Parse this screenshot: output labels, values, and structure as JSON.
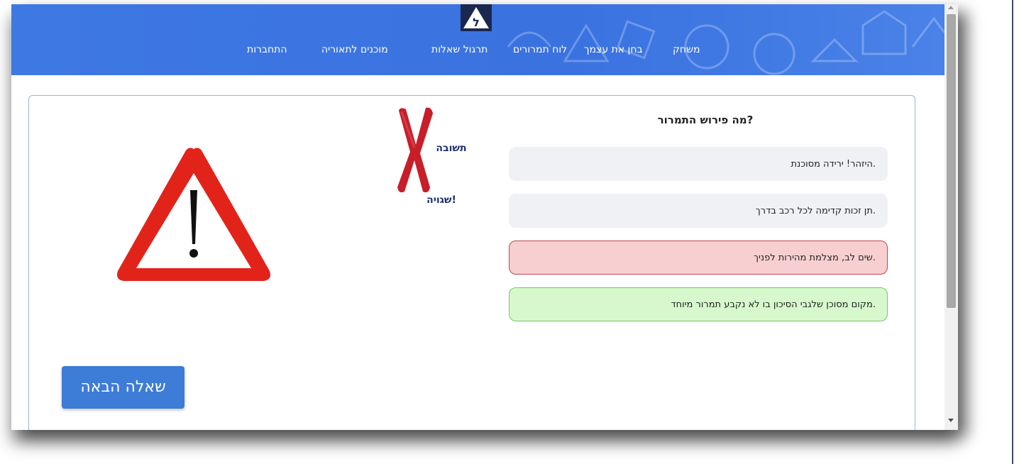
{
  "nav": {
    "items": [
      "משחק",
      "בחן את עצמך",
      "לוח תמרורים",
      "תרגול שאלות",
      "מוכנים לתאוריה",
      "התחברות"
    ]
  },
  "logo": {
    "glyph": "ל"
  },
  "quiz": {
    "question": "?מה פירוש התמרור",
    "options": [
      {
        "text": ".היזהר! ירידה מסוכנת",
        "state": "neutral"
      },
      {
        "text": ".תן זכות קדימה לכל רכב בדרך",
        "state": "neutral"
      },
      {
        "text": ".שים לב, מצלמת מהירות לפניך",
        "state": "wrong"
      },
      {
        "text": ".מקום מסוכן שלגבי הסיכון בו לא נקבע תמרור מיוחד",
        "state": "correct"
      }
    ],
    "answer_label": "תשובה",
    "answer_result": "!שגויה",
    "next_button": "שאלה הבאה"
  },
  "colors": {
    "header": "#3e78e3",
    "wrong_bg": "#f8cfd0",
    "wrong_border": "#c0464b",
    "correct_bg": "#d7f8cc",
    "correct_border": "#78c46a",
    "button": "#3d7cd7",
    "x_mark": "#c81e2a",
    "sign_red": "#e2231a"
  },
  "icons": [
    "logo-icon",
    "wrong-x-icon",
    "warning-sign-icon"
  ]
}
